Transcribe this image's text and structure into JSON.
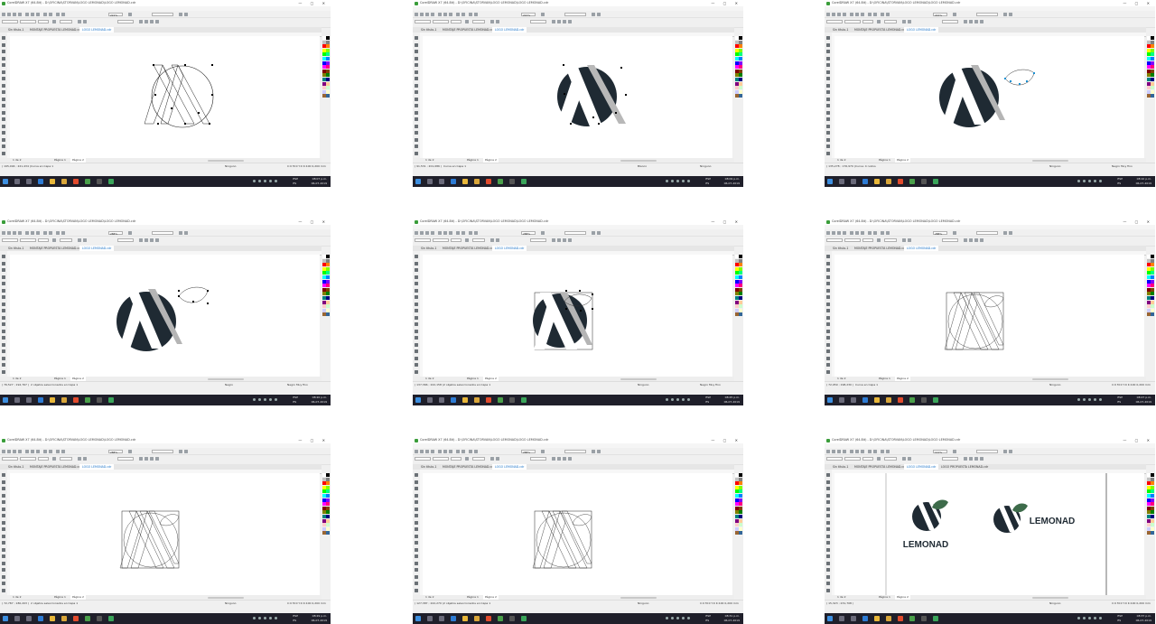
{
  "app": {
    "title": "CorelDRAW X7 (64-Bit) - D:\\OFICINA\\STORVAN\\LOGO LEMONAD\\LOGO LEMONAD.cdr",
    "window_controls": "— ▢ ✕",
    "menu": [
      "Archivo",
      "Edición",
      "Ver",
      "Diseño",
      "Objeto",
      "Efectos",
      "Mapas de bits",
      "Texto",
      "Tabla",
      "Herramientas",
      "Ventana",
      "Ayuda"
    ]
  },
  "tabs": [
    "Sin título-1",
    "MONTAJE PROPUESTA LEMONAD.cdr",
    "LOGO LEMONAD.cdr"
  ],
  "tab_extra": "LOGO PROPUESTA LEMONAD.cdr",
  "pages": {
    "counter": "1 de 2",
    "page1": "Página 1",
    "page2": "Página 2"
  },
  "taskbar": {
    "lang": "ESP\nES",
    "time": "08:07 p.m.\n06-07-2019"
  },
  "colors": {
    "accent": "#1a73c8",
    "logo_dark": "#1f2a33",
    "logo_green": "#3d6b4a",
    "taskbar": "#1f1f2a"
  },
  "logo_text": "LEMONAD",
  "shots": [
    {
      "id": "s1",
      "zoom": "221%",
      "coords": "( 195,094 ; 221,434 )",
      "object": "Curva en Capa 1",
      "fill": "Ninguno",
      "outline": "C:0 M:0 Y:0 K:100  0,200 mm",
      "clock": "08:07 p.m.\n06-07-2019"
    },
    {
      "id": "s2",
      "zoom": "221%",
      "coords": "( 91,531 ; 201,086 )",
      "object": "Curva en Capa 1",
      "fill": "Blanco",
      "outline": "Ninguno",
      "clock": "08:09 p.m.\n06-07-2019"
    },
    {
      "id": "s3",
      "zoom": "221%",
      "coords": "( 135,278 ; 176,970 )",
      "object": "Curva: 4 nodos",
      "fill": "Ninguno",
      "outline": "Negro Muy fino",
      "clock": "08:10 p.m.\n06-07-2019"
    },
    {
      "id": "s4",
      "zoom": "288%",
      "coords": "( 76,527 ; 192,767 )",
      "object": "2 objetos seleccionados en Capa 1",
      "fill": "Negro",
      "outline": "Negro Muy fino",
      "clock": "08:20 p.m.\n06-07-2019"
    },
    {
      "id": "s5",
      "zoom": "288%",
      "coords": "( 137,366 ; 222,158 )",
      "object": "2 objetos seleccionados en Capa 1",
      "fill": "Ninguno",
      "outline": "Negro Muy fino",
      "clock": "08:25 p.m.\n06-07-2019"
    },
    {
      "id": "s6",
      "zoom": "288%",
      "coords": "( 72,959 ; 198,230 )",
      "object": "Curva en Capa 1",
      "fill": "Ninguno",
      "outline": "C:0 M:0 Y:0 K:100  0,200 mm",
      "clock": "08:27 p.m.\n06-07-2019"
    },
    {
      "id": "s7",
      "zoom": "288%",
      "coords": "( 72,787 ; 180,203 )",
      "object": "2 objetos seleccionados en Capa 1",
      "fill": "Ninguno",
      "outline": "C:0 M:0 Y:0 K:100  0,200 mm",
      "clock": "08:29 p.m.\n06-07-2019"
    },
    {
      "id": "s8",
      "zoom": "288%",
      "coords": "( 127,387 ; 222,270 )",
      "object": "2 objetos seleccionados en Capa 1",
      "fill": "Ninguno",
      "outline": "C:0 M:0 Y:0 K:100  0,200 mm",
      "clock": "08:31 p.m.\n06-07-2019"
    },
    {
      "id": "s9",
      "zoom": "111%",
      "coords": "( 15,323 ; 231,708 )",
      "object": "",
      "fill": "Ninguno",
      "outline": "C:0 M:0 Y:0 K:100  0,200 mm",
      "clock": "08:37 p.m.\n06-07-2019"
    }
  ]
}
